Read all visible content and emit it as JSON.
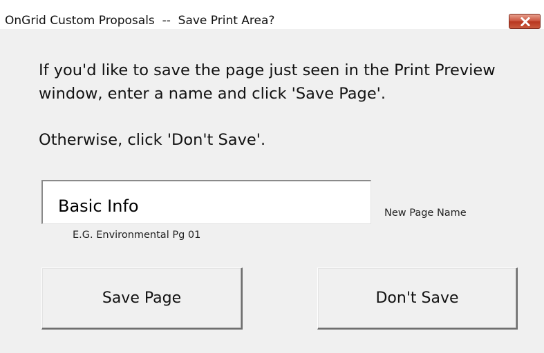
{
  "window": {
    "title": "OnGrid Custom Proposals  --  Save Print Area?",
    "close_icon": "close-icon",
    "close_color": "#c9503a"
  },
  "message": {
    "line1": "If you'd like to save the page just seen in the Print Preview",
    "line2": "window, enter a name and click 'Save Page'.",
    "line3": "Otherwise, click 'Don't Save'."
  },
  "page_name": {
    "value": "Basic Info",
    "label": "New Page Name",
    "example": "E.G. Environmental Pg 01"
  },
  "buttons": {
    "save_label": "Save Page",
    "dont_save_label": "Don't Save"
  }
}
